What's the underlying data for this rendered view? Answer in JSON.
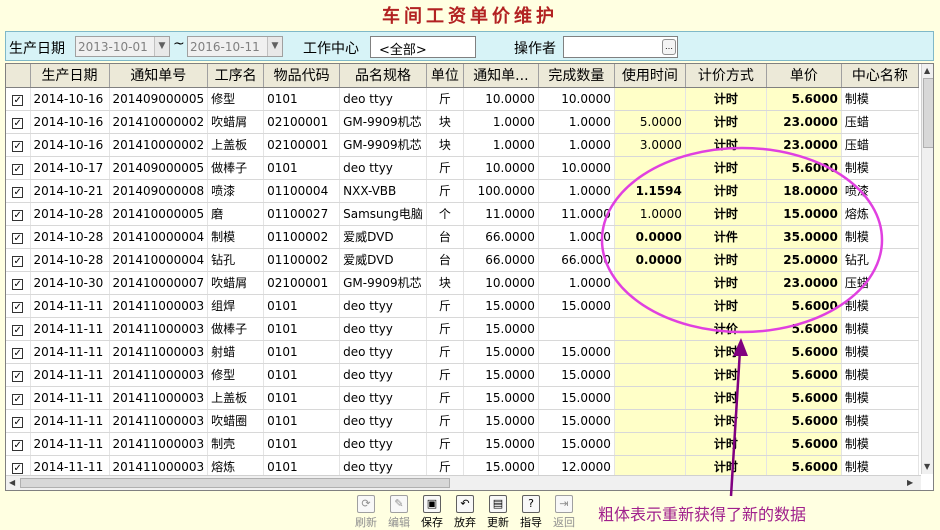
{
  "title": "车间工资单价维护",
  "filters": {
    "date_label": "生产日期",
    "date_from": "2013-10-01",
    "date_sep": "~",
    "date_to": "2016-10-11",
    "center_label": "工作中心",
    "center_value": "<全部>",
    "operator_label": "操作者",
    "operator_value": ""
  },
  "columns": [
    "生产日期",
    "通知单号",
    "工序名",
    "物品代码",
    "品名规格",
    "单位",
    "通知单...",
    "完成数量",
    "使用时间",
    "计价方式",
    "单价",
    "中心名称"
  ],
  "rows": [
    {
      "checked": true,
      "date": "2014-10-16",
      "notice": "201409000005",
      "process": "修型",
      "code": "0101",
      "spec": "deo ttyy",
      "unit": "斤",
      "notice_qty": "10.0000",
      "done_qty": "10.0000",
      "time": "",
      "method": "计时",
      "price": "5.6000",
      "center": "制模"
    },
    {
      "checked": true,
      "date": "2014-10-16",
      "notice": "201410000002",
      "process": "吹蜡屑",
      "code": "02100001",
      "spec": "GM-9909机芯",
      "unit": "块",
      "notice_qty": "1.0000",
      "done_qty": "1.0000",
      "time": "5.0000",
      "method": "计时",
      "price": "23.0000",
      "center": "压蜡"
    },
    {
      "checked": true,
      "date": "2014-10-16",
      "notice": "201410000002",
      "process": "上盖板",
      "code": "02100001",
      "spec": "GM-9909机芯",
      "unit": "块",
      "notice_qty": "1.0000",
      "done_qty": "1.0000",
      "time": "3.0000",
      "method": "计时",
      "price": "23.0000",
      "center": "压蜡"
    },
    {
      "checked": true,
      "date": "2014-10-17",
      "notice": "201409000005",
      "process": "做棒子",
      "code": "0101",
      "spec": "deo ttyy",
      "unit": "斤",
      "notice_qty": "10.0000",
      "done_qty": "10.0000",
      "time": "",
      "method": "计时",
      "price": "5.6000",
      "center": "制模"
    },
    {
      "checked": true,
      "date": "2014-10-21",
      "notice": "201409000008",
      "process": "喷漆",
      "code": "01100004",
      "spec": "NXX-VBB",
      "unit": "斤",
      "notice_qty": "100.0000",
      "done_qty": "1.0000",
      "time": "1.1594",
      "time_bold": true,
      "method": "计时",
      "price": "18.0000",
      "center": "喷漆"
    },
    {
      "checked": true,
      "date": "2014-10-28",
      "notice": "201410000005",
      "process": "磨",
      "code": "01100027",
      "spec": "Samsung电脑",
      "unit": "个",
      "notice_qty": "11.0000",
      "done_qty": "11.0000",
      "time": "1.0000",
      "method": "计时",
      "price": "15.0000",
      "center": "熔炼"
    },
    {
      "checked": true,
      "date": "2014-10-28",
      "notice": "201410000004",
      "process": "制模",
      "code": "01100002",
      "spec": "爱威DVD",
      "unit": "台",
      "notice_qty": "66.0000",
      "done_qty": "1.0000",
      "time": "0.0000",
      "time_bold": true,
      "method": "计件",
      "price": "35.0000",
      "center": "制模"
    },
    {
      "checked": true,
      "date": "2014-10-28",
      "notice": "201410000004",
      "process": "钻孔",
      "code": "01100002",
      "spec": "爱威DVD",
      "unit": "台",
      "notice_qty": "66.0000",
      "done_qty": "66.0000",
      "time": "0.0000",
      "time_bold": true,
      "method": "计时",
      "price": "25.0000",
      "center": "钻孔"
    },
    {
      "checked": true,
      "date": "2014-10-30",
      "notice": "201410000007",
      "process": "吹蜡屑",
      "code": "02100001",
      "spec": "GM-9909机芯",
      "unit": "块",
      "notice_qty": "10.0000",
      "done_qty": "1.0000",
      "time": "",
      "method": "计时",
      "price": "23.0000",
      "center": "压蜡"
    },
    {
      "checked": true,
      "date": "2014-11-11",
      "notice": "201411000003",
      "process": "组焊",
      "code": "0101",
      "spec": "deo ttyy",
      "unit": "斤",
      "notice_qty": "15.0000",
      "done_qty": "15.0000",
      "time": "",
      "method": "计时",
      "price": "5.6000",
      "center": "制模"
    },
    {
      "checked": true,
      "date": "2014-11-11",
      "notice": "201411000003",
      "process": "做棒子",
      "code": "0101",
      "spec": "deo ttyy",
      "unit": "斤",
      "notice_qty": "15.0000",
      "done_qty": "",
      "time": "",
      "method": "计价",
      "price": "5.6000",
      "center": "制模"
    },
    {
      "checked": true,
      "date": "2014-11-11",
      "notice": "201411000003",
      "process": "射蜡",
      "code": "0101",
      "spec": "deo ttyy",
      "unit": "斤",
      "notice_qty": "15.0000",
      "done_qty": "15.0000",
      "time": "",
      "method": "计时",
      "price": "5.6000",
      "center": "制模"
    },
    {
      "checked": true,
      "date": "2014-11-11",
      "notice": "201411000003",
      "process": "修型",
      "code": "0101",
      "spec": "deo ttyy",
      "unit": "斤",
      "notice_qty": "15.0000",
      "done_qty": "15.0000",
      "time": "",
      "method": "计时",
      "price": "5.6000",
      "center": "制模"
    },
    {
      "checked": true,
      "date": "2014-11-11",
      "notice": "201411000003",
      "process": "上盖板",
      "code": "0101",
      "spec": "deo ttyy",
      "unit": "斤",
      "notice_qty": "15.0000",
      "done_qty": "15.0000",
      "time": "",
      "method": "计时",
      "price": "5.6000",
      "center": "制模"
    },
    {
      "checked": true,
      "date": "2014-11-11",
      "notice": "201411000003",
      "process": "吹蜡圈",
      "code": "0101",
      "spec": "deo ttyy",
      "unit": "斤",
      "notice_qty": "15.0000",
      "done_qty": "15.0000",
      "time": "",
      "method": "计时",
      "price": "5.6000",
      "center": "制模"
    },
    {
      "checked": true,
      "date": "2014-11-11",
      "notice": "201411000003",
      "process": "制壳",
      "code": "0101",
      "spec": "deo ttyy",
      "unit": "斤",
      "notice_qty": "15.0000",
      "done_qty": "15.0000",
      "time": "",
      "method": "计时",
      "price": "5.6000",
      "center": "制模"
    },
    {
      "checked": true,
      "date": "2014-11-11",
      "notice": "201411000003",
      "process": "熔炼",
      "code": "0101",
      "spec": "deo ttyy",
      "unit": "斤",
      "notice_qty": "15.0000",
      "done_qty": "12.0000",
      "time": "",
      "method": "计时",
      "price": "5.6000",
      "center": "制模"
    }
  ],
  "toolbar": [
    {
      "label": "刷新",
      "icon": "refresh-icon",
      "glyph": "⟳",
      "enabled": false
    },
    {
      "label": "编辑",
      "icon": "edit-icon",
      "glyph": "✎",
      "enabled": false
    },
    {
      "label": "保存",
      "icon": "save-icon",
      "glyph": "▣",
      "enabled": true
    },
    {
      "label": "放弃",
      "icon": "undo-icon",
      "glyph": "↶",
      "enabled": true
    },
    {
      "label": "更新",
      "icon": "update-icon",
      "glyph": "▤",
      "enabled": true
    },
    {
      "label": "指导",
      "icon": "help-icon",
      "glyph": "?",
      "enabled": true
    },
    {
      "label": "返回",
      "icon": "exit-icon",
      "glyph": "⇥",
      "enabled": false
    }
  ],
  "annotation": {
    "text": "粗体表示重新获得了新的数据",
    "color": "#e040e0"
  },
  "colors": {
    "background": "#ffffe1",
    "filterbar": "#d7f3f7",
    "highlight_cell": "#ffffc8",
    "title": "#b22222"
  }
}
